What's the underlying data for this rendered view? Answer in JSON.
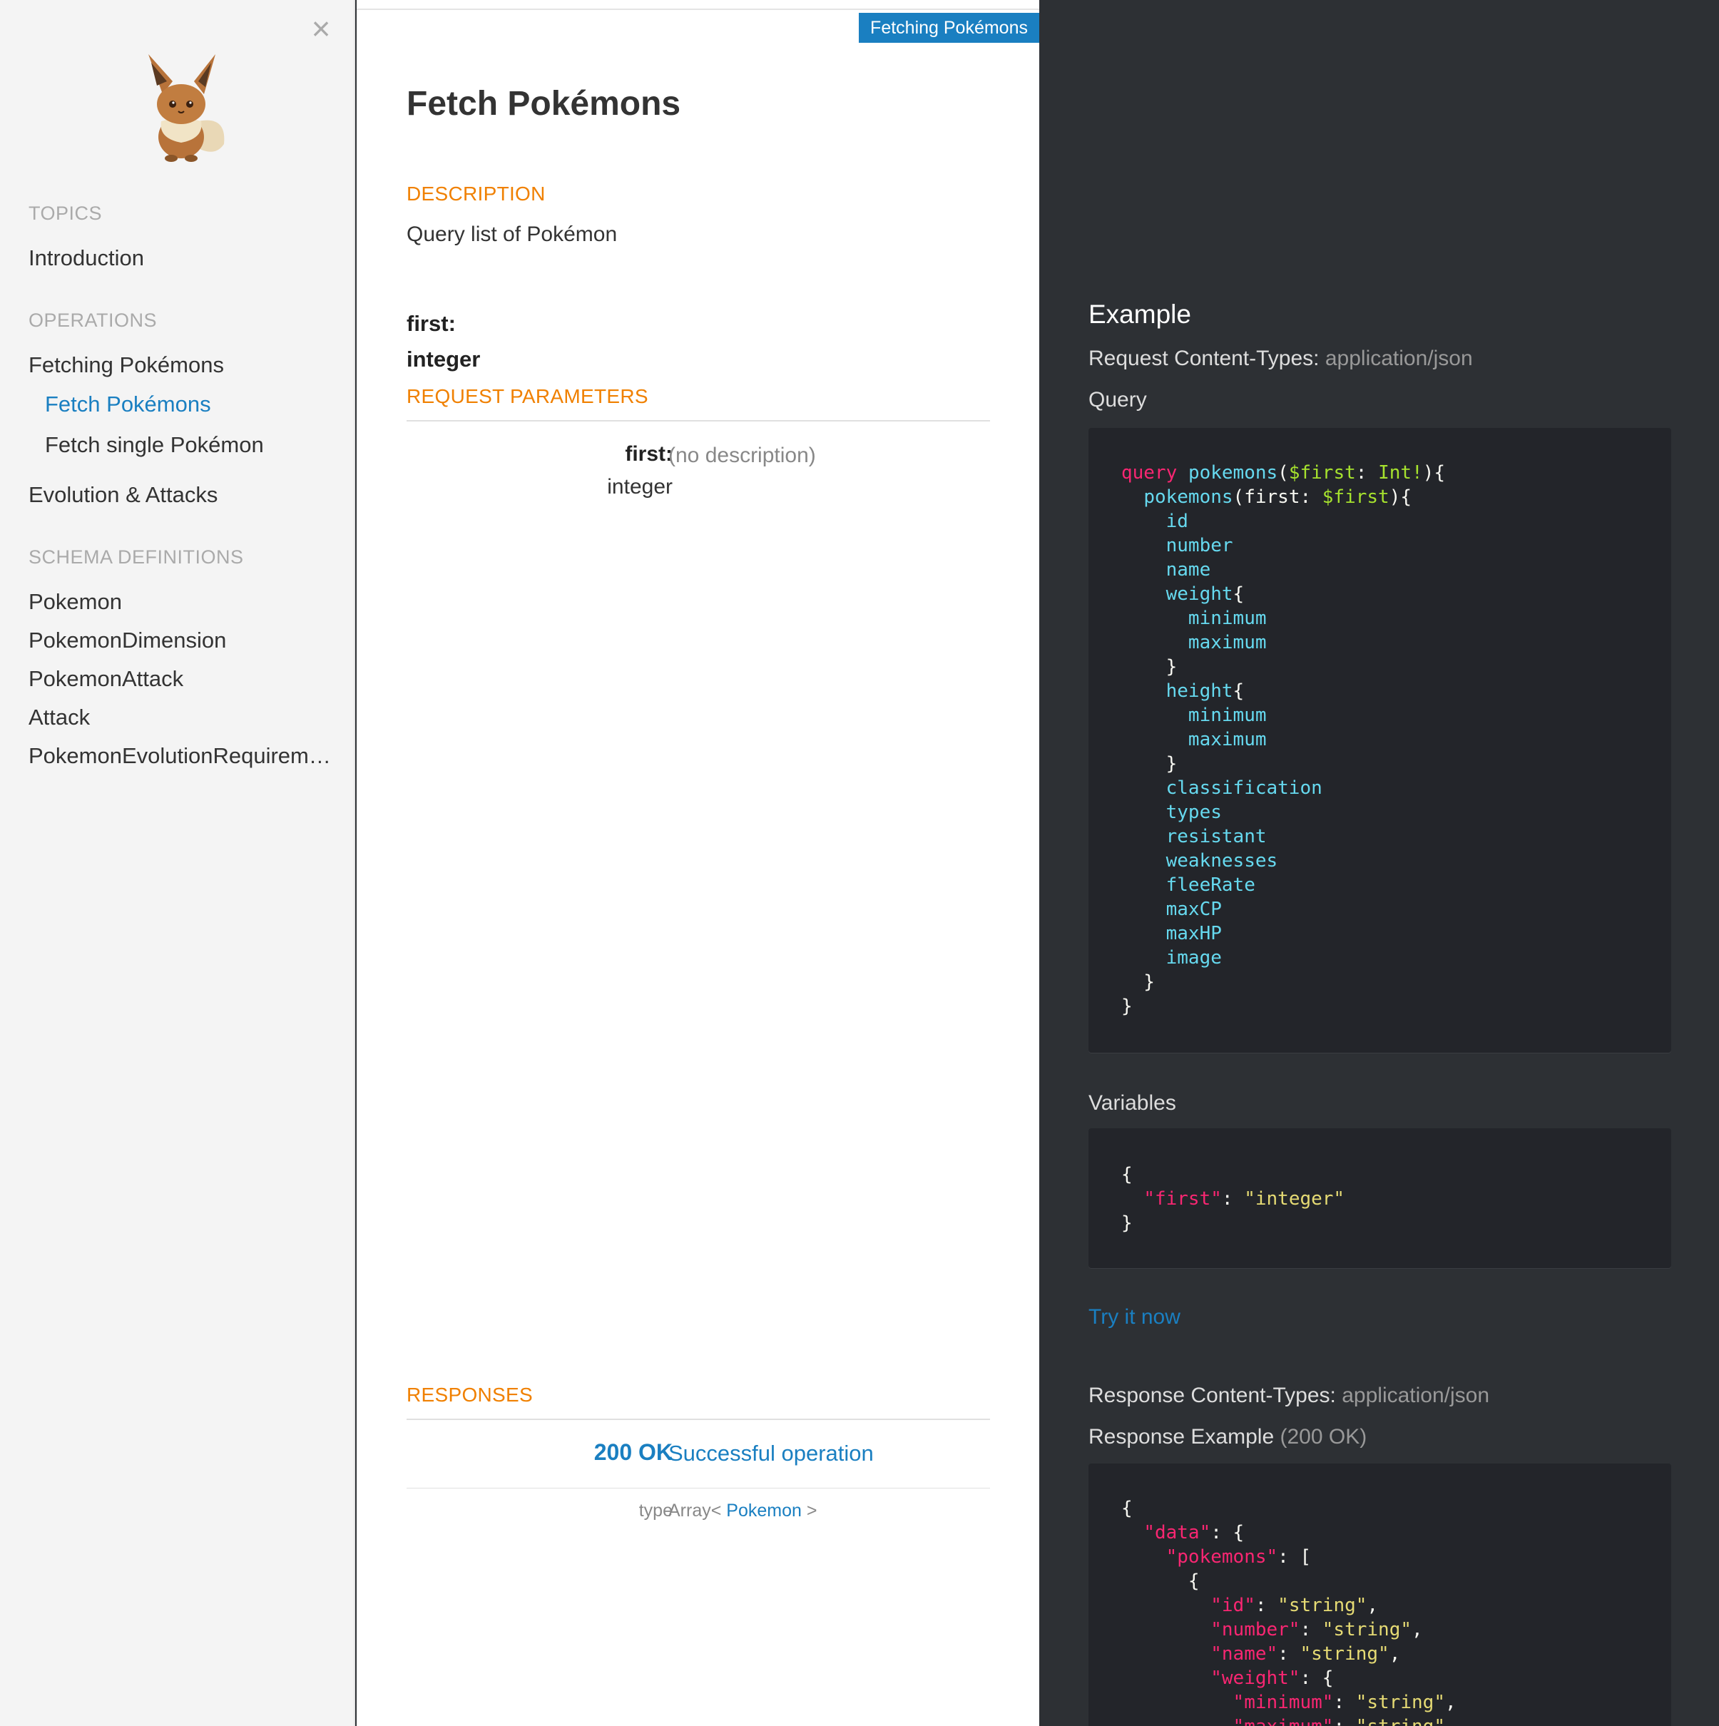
{
  "sidebar": {
    "close_glyph": "×",
    "logo": "eevee-logo",
    "topics_heading": "TOPICS",
    "topics": [
      "Introduction"
    ],
    "operations_heading": "OPERATIONS",
    "operations": [
      {
        "label": "Fetching Pokémons"
      },
      {
        "label": "Fetch Pokémons"
      },
      {
        "label": "Fetch single Pokémon"
      },
      {
        "label": "Evolution & Attacks"
      }
    ],
    "schema_heading": "SCHEMA DEFINITIONS",
    "schemas": [
      "Pokemon",
      "PokemonDimension",
      "PokemonAttack",
      "Attack",
      "PokemonEvolutionRequirem…"
    ]
  },
  "main": {
    "section_tag": "Fetching Pokémons",
    "title": "Fetch Pokémons",
    "description_heading": "DESCRIPTION",
    "description": "Query list of Pokémon",
    "arg_name": "first:",
    "arg_type": "integer",
    "request_params_heading": "REQUEST PARAMETERS",
    "param": {
      "name": "first:",
      "type": "integer",
      "description": "(no description)"
    },
    "responses_heading": "RESPONSES",
    "response": {
      "code": "200 OK",
      "description": "Successful operation",
      "type_label": "type",
      "type_prefix": "Array<",
      "type_link": "Pokemon",
      "type_suffix": ">"
    }
  },
  "example": {
    "title": "Example",
    "request_content_types_label": "Request Content-Types:",
    "request_content_types_value": "application/json",
    "query_label": "Query",
    "variables_label": "Variables",
    "try_it": "Try it now",
    "response_content_types_label": "Response Content-Types:",
    "response_content_types_value": "application/json",
    "response_example_label": "Response Example",
    "response_example_status": "(200 OK)"
  },
  "colors": {
    "accent": "#1a7fc1",
    "orange": "#f08000",
    "dark_panel": "#2d3034",
    "code_bg": "#23252a"
  }
}
